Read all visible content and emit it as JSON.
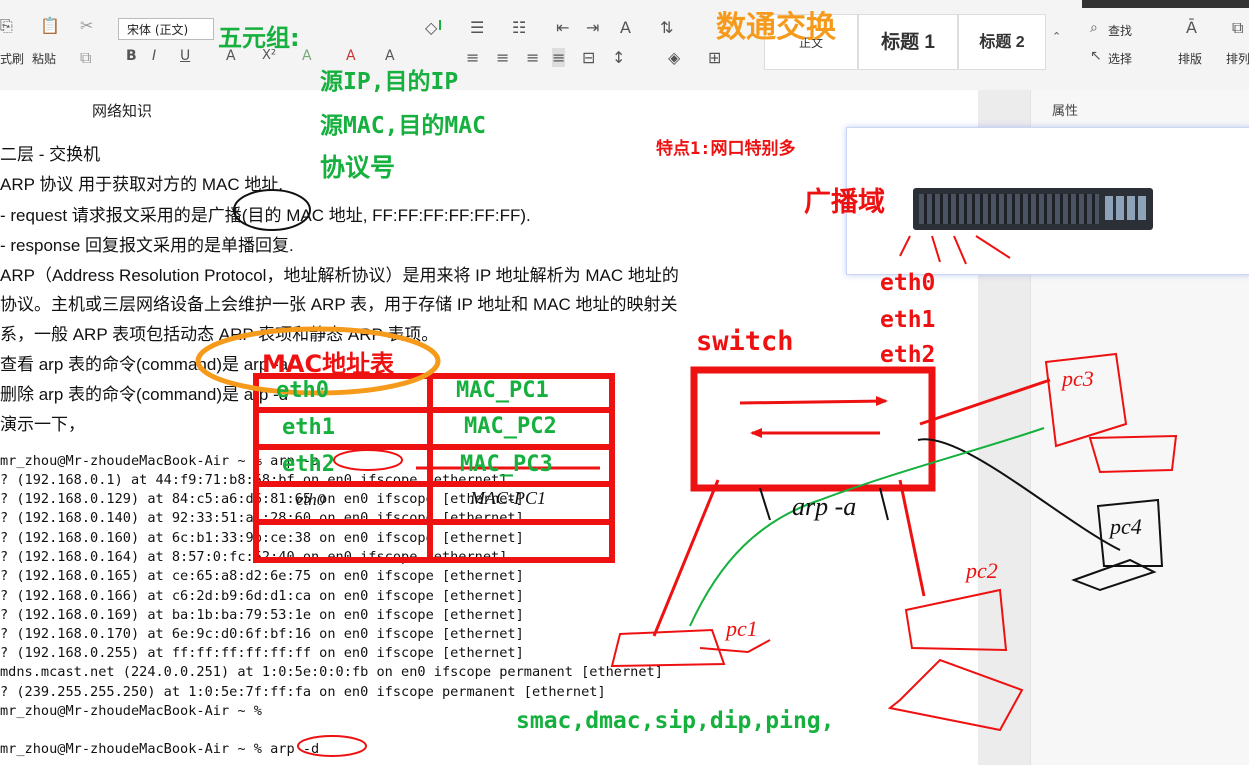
{
  "ribbon": {
    "format_label": "式刷",
    "paste_label": "粘贴",
    "font_name": "宋体 (正文)",
    "style_normal": "正文",
    "style_h1": "标题 1",
    "style_h2": "标题 2",
    "find_label": "查找",
    "select_label": "选择",
    "sort_label": "排版",
    "sort2_label": "排列"
  },
  "document": {
    "title": "网络知识",
    "side_panel_label": "属性",
    "lines": [
      "二层 - 交换机",
      "ARP 协议  用于获取对方的 MAC 地址.",
      "- request 请求报文采用的是广播(目的 MAC 地址,  FF:FF:FF:FF:FF:FF).",
      "- response  回复报文采用的是单播回复.",
      "ARP（Address Resolution Protocol，地址解析协议）是用来将 IP 地址解析为 MAC 地址的",
      "协议。主机或三层网络设备上会维护一张 ARP 表，用于存储 IP 地址和 MAC 地址的映射关",
      "系，一般 ARP 表项包括动态 ARP 表项和静态 ARP 表项。",
      "查看 arp 表的命令(command)是 arp -a",
      "删除 arp 表的命令(command)是 arp -d",
      "演示一下，"
    ],
    "terminal": [
      "mr_zhou@Mr-zhoudeMacBook-Air ~ % arp -a",
      "? (192.168.0.1) at 44:f9:71:b8:58:bf on en0 ifscope [ethernet]",
      "? (192.168.0.129) at 84:c5:a6:d6:81:65 on en0 ifscope [ethernet]",
      "? (192.168.0.140) at 92:33:51:a1:28:60 on en0 ifscope [ethernet]",
      "? (192.168.0.160) at 6c:b1:33:9b:ce:38 on en0 ifscope [ethernet]",
      "? (192.168.0.164) at 8:57:0:fc:52:40 on en0 ifscope [ethernet]",
      "? (192.168.0.165) at ce:65:a8:d2:6e:75 on en0 ifscope [ethernet]",
      "? (192.168.0.166) at c6:2d:b9:6d:d1:ca on en0 ifscope [ethernet]",
      "? (192.168.0.169) at ba:1b:ba:79:53:1e on en0 ifscope [ethernet]",
      "? (192.168.0.170) at 6e:9c:d0:6f:bf:16 on en0 ifscope [ethernet]",
      "? (192.168.0.255) at ff:ff:ff:ff:ff:ff on en0 ifscope [ethernet]",
      "mdns.mcast.net (224.0.0.251) at 1:0:5e:0:0:fb on en0 ifscope permanent [ethernet]",
      "? (239.255.255.250) at 1:0:5e:7f:ff:fa on en0 ifscope permanent [ethernet]",
      "mr_zhou@Mr-zhoudeMacBook-Air ~ %",
      "",
      "mr_zhou@Mr-zhoudeMacBook-Air ~ % arp -d"
    ]
  },
  "annotations": {
    "tuple_title": "五元组:",
    "tuple_ip": "源IP,目的IP",
    "tuple_mac": "源MAC,目的MAC",
    "tuple_proto": "协议号",
    "data_switching": "数通交换",
    "feature1": "特点1:网口特别多",
    "broadcast_domain": "广播域",
    "eth0": "eth0",
    "eth1": "eth1",
    "eth2": "eth2",
    "switch": "switch",
    "mac_table": "MAC地址表",
    "table_rows": [
      {
        "port": "eth0",
        "mac": "MAC_PC1"
      },
      {
        "port": "eth1",
        "mac": "MAC_PC2"
      },
      {
        "port": "eth2",
        "mac": "MAC_PC3"
      }
    ],
    "bottom_fields": "smac,dmac,sip,dip,ping,",
    "hand_arp": "arp -a",
    "hand_pc1": "pc1",
    "hand_pc2": "pc2",
    "hand_pc3": "pc3",
    "hand_pc4": "pc4",
    "hand_eth0": "eth0",
    "hand_mac_pc": "MAC-PC1"
  },
  "colors": {
    "annotation_green": "#16b03e",
    "annotation_red": "#ee1111",
    "annotation_orange": "#f59a1a"
  }
}
